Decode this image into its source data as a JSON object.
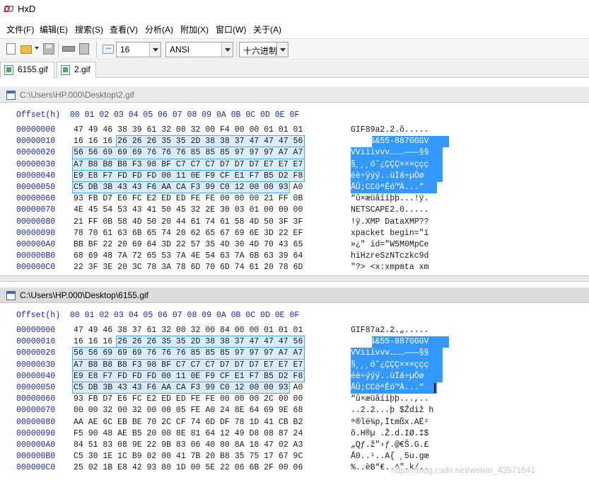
{
  "app": {
    "title": "HxD"
  },
  "menu": [
    "文件(F)",
    "编辑(E)",
    "搜索(S)",
    "查看(V)",
    "分析(A)",
    "附加(X)",
    "窗口(W)",
    "关于(A)"
  ],
  "toolbar": {
    "icons": [
      "new-file-icon",
      "open-file-icon",
      "save-icon",
      "open-ram-icon",
      "open-disk-icon",
      "bytes-per-row-icon"
    ],
    "bytes_per_row": "16",
    "charset": "ANSI",
    "offset_base": "十六进制"
  },
  "tabs": [
    {
      "label": "6155.gif",
      "active": false
    },
    {
      "label": "2.gif",
      "active": true
    }
  ],
  "panels": [
    {
      "path": "C:\\Users\\HP.000\\Desktop\\2.gif",
      "header": "Offset(h)  00 01 02 03 04 05 06 07 08 09 0A 0B 0C 0D 0E 0F",
      "rows": [
        {
          "offset": "00000000",
          "bytes": "47 49 46 38 39 61 32 00 32 00 F4 00 00 01 01 01",
          "text": "GIF89a2.2.ô....."
        },
        {
          "offset": "00000010",
          "bytes": "16 16 16 26 26 26 35 35 2D 38 38 37 47 47 47 56",
          "text": "...&&&55-887GGGV"
        },
        {
          "offset": "00000020",
          "bytes": "56 56 69 69 69 76 76 76 85 85 85 97 97 97 A7 A7",
          "text": "VViiivvv………———§§"
        },
        {
          "offset": "00000030",
          "bytes": "A7 B8 B8 B8 F3 98 BF C7 C7 C7 D7 D7 D7 E7 E7 E7",
          "text": "§¸¸¸ó˜¿ÇÇÇ×××ççç"
        },
        {
          "offset": "00000040",
          "bytes": "E9 E8 F7 FD FD FD 00 11 0E F9 CF E1 F7 B5 D2 F8",
          "text": "éè÷ýýý..ùÏá÷µÒø"
        },
        {
          "offset": "00000050",
          "bytes": "C5 DB 3B 43 43 F6 AA CA F3 99 C0 12 00 00 93 A0",
          "text": "ÅÛ;CCöªÊó™À...“ "
        },
        {
          "offset": "00000060",
          "bytes": "93 FB D7 E6 FC E2 ED ED FE FE 00 00 00 21 FF 0B",
          "text": "“û×æüâííþþ...!ÿ."
        },
        {
          "offset": "00000070",
          "bytes": "4E 45 54 53 43 41 50 45 32 2E 30 03 01 00 00 00",
          "text": "NETSCAPE2.0....."
        },
        {
          "offset": "00000080",
          "bytes": "21 FF 0B 58 4D 50 20 44 61 74 61 58 4D 50 3F 3F",
          "text": "!ÿ.XMP DataXMP??"
        },
        {
          "offset": "00000090",
          "bytes": "78 70 61 63 6B 65 74 20 62 65 67 69 6E 3D 22 EF",
          "text": "xpacket begin=\"ï"
        },
        {
          "offset": "000000A0",
          "bytes": "BB BF 22 20 69 64 3D 22 57 35 4D 30 4D 70 43 65",
          "text": "»¿\" id=\"W5M0MpCe"
        },
        {
          "offset": "000000B0",
          "bytes": "68 69 48 7A 72 65 53 7A 4E 54 63 7A 6B 63 39 64",
          "text": "hiHzreSzNTczkc9d"
        },
        {
          "offset": "000000C0",
          "bytes": "22 3F 3E 20 3C 78 3A 78 6D 70 6D 74 61 20 78 6D",
          "text": "\"?> <x:xmpmta xm"
        }
      ]
    },
    {
      "path": "C:\\Users\\HP.000\\Desktop\\6155.gif",
      "header": "Offset(h)  00 01 02 03 04 05 06 07 08 09 0A 0B 0C 0D 0E 0F",
      "rows": [
        {
          "offset": "00000000",
          "bytes": "47 49 46 38 37 61 32 00 32 00 84 00 00 01 01 01",
          "text": "GIF87a2.2.„....."
        },
        {
          "offset": "00000010",
          "bytes": "16 16 16 26 26 26 35 35 2D 38 38 37 47 47 47 56",
          "text": "...&&&55-887GGGV"
        },
        {
          "offset": "00000020",
          "bytes": "56 56 69 69 69 76 76 76 85 85 85 97 97 97 A7 A7",
          "text": "VViiivvv………———§§"
        },
        {
          "offset": "00000030",
          "bytes": "A7 B8 B8 B8 F3 98 BF C7 C7 C7 D7 D7 D7 E7 E7 E7",
          "text": "§¸¸¸ó˜¿ÇÇÇ×××ççç"
        },
        {
          "offset": "00000040",
          "bytes": "E9 E8 F7 FD FD FD 00 11 0E F9 CF E1 F7 B5 D2 F8",
          "text": "éè÷ýýý..ùÏá÷µÒø"
        },
        {
          "offset": "00000050",
          "bytes": "C5 DB 3B 43 43 F6 AA CA F3 99 C0 12 00 00 93 A0",
          "text": "ÅÛ;CCöªÊó™À...“ "
        },
        {
          "offset": "00000060",
          "bytes": "93 FB D7 E6 FC E2 ED ED FE FE 00 00 00 2C 00 00",
          "text": "“û×æüâííþþ...,.."
        },
        {
          "offset": "00000070",
          "bytes": "00 00 32 00 32 00 00 05 FE A0 24 8E 64 69 9E 68",
          "text": "..2.2...þ $Ždiž h"
        },
        {
          "offset": "00000080",
          "bytes": "AA AE 6C EB BE 70 2C CF 74 6D DF 78 1D 41 CB B2",
          "text": "ª®lë¾p,Ïtmßx.AË²"
        },
        {
          "offset": "00000090",
          "bytes": "F5 90 48 AE B5 20 00 8E 81 64 12 49 D8 08 87 24",
          "text": "õ.H®µ .Ž.d.IØ.‡$"
        },
        {
          "offset": "000000A0",
          "bytes": "84 51 83 08 9E 22 9B 83 06 40 80 8A 18 47 02 A3",
          "text": "„Qƒ.ž\"›ƒ.@€Š.G.£"
        },
        {
          "offset": "000000B0",
          "bytes": "C5 30 1E 1C B9 02 00 41 7B 20 B8 35 75 17 67 9C",
          "text": "Å0..¹..A{ ¸5u.gœ"
        },
        {
          "offset": "000000C0",
          "bytes": "25 02 1B E8 42 93 80 1D 00 5E 22 06 6B 2F 00 06",
          "text": "%..èB“€..^\".k/.."
        }
      ]
    }
  ],
  "watermark": "https://blog.csdn.net/weixin_43571641"
}
